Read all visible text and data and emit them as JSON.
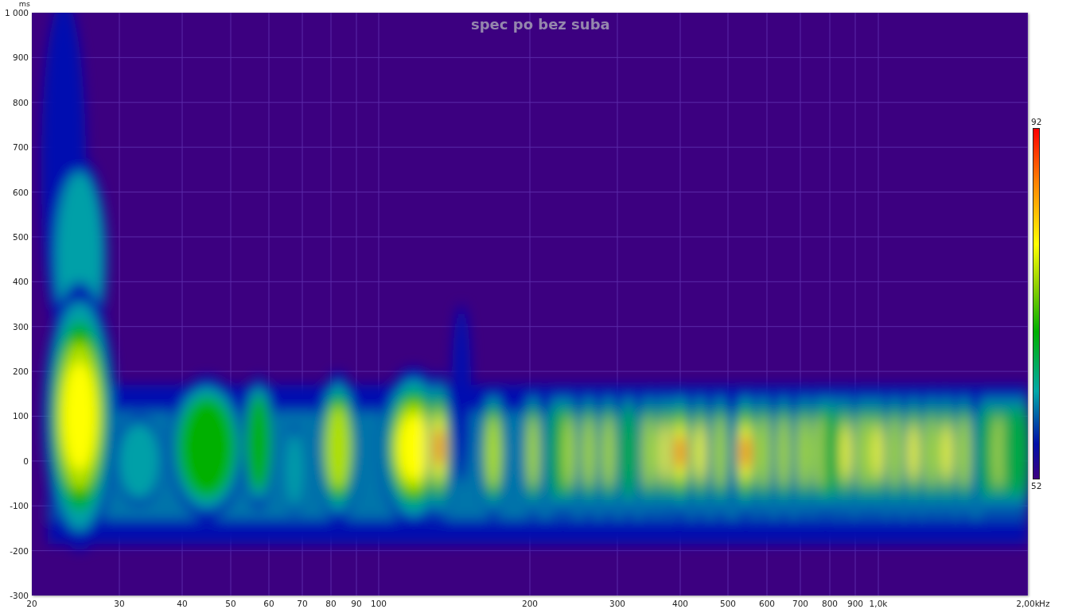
{
  "chart": {
    "title": "spec po bez suba",
    "y_unit": "ms",
    "x_unit": "Hz",
    "y_ticks": [
      "1 000",
      "900",
      "800",
      "700",
      "600",
      "500",
      "400",
      "300",
      "200",
      "100",
      "0",
      "-100",
      "-200",
      "-300"
    ],
    "x_ticks": [
      "20",
      "30",
      "40",
      "50",
      "60",
      "70",
      "80",
      "90",
      "100",
      "200",
      "300",
      "400",
      "500",
      "600",
      "700",
      "800",
      "900",
      "1,0k",
      "2,00k"
    ]
  },
  "color_scale": {
    "max": "92",
    "min": "52"
  }
}
